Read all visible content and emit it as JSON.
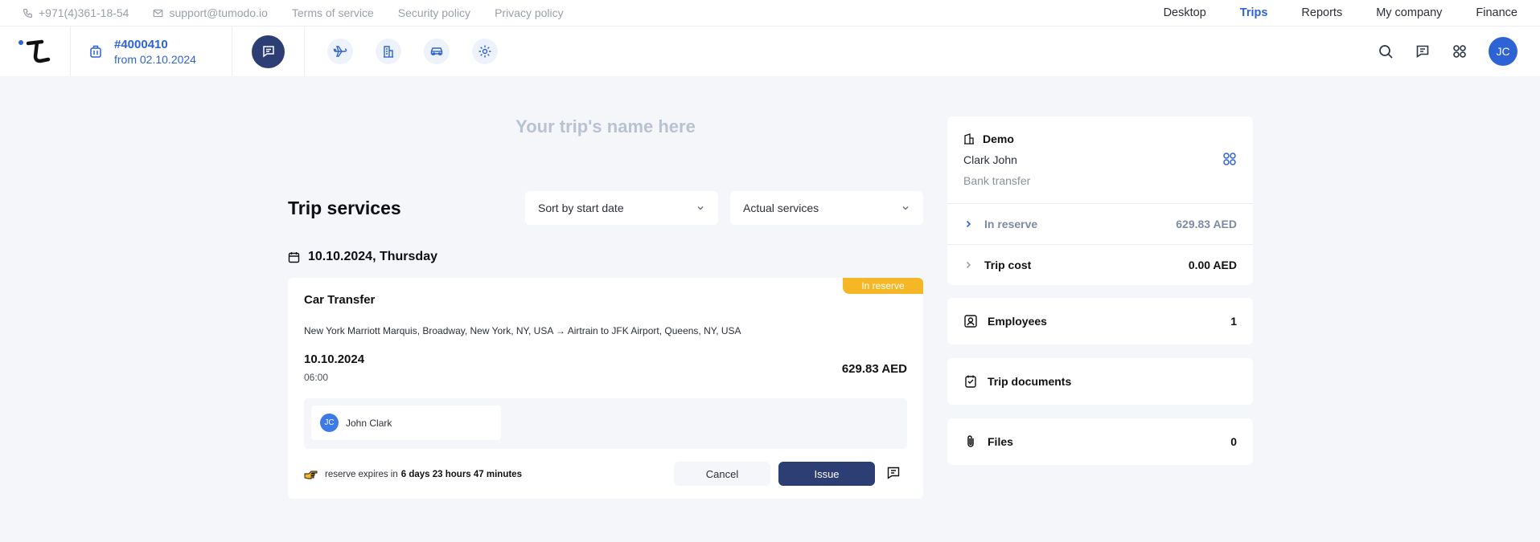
{
  "topbar": {
    "phone": "+971(4)361-18-54",
    "email": "support@tumodo.io",
    "links": [
      "Terms of service",
      "Security policy",
      "Privacy policy"
    ],
    "nav": [
      {
        "label": "Desktop",
        "active": false
      },
      {
        "label": "Trips",
        "active": true
      },
      {
        "label": "Reports",
        "active": false
      },
      {
        "label": "My company",
        "active": false
      },
      {
        "label": "Finance",
        "active": false
      }
    ]
  },
  "header": {
    "trip_number": "#4000410",
    "trip_from": "from 02.10.2024",
    "avatar_initials": "JC",
    "service_icons": [
      "airplane-icon",
      "hotel-icon",
      "car-icon",
      "settings-gear-icon"
    ],
    "right_icons": [
      "search-icon",
      "chat-icon",
      "apps-grid-icon"
    ]
  },
  "main": {
    "trip_name_placeholder": "Your trip's name here",
    "section_title": "Trip services",
    "sort_select": "Sort by start date",
    "filter_select": "Actual services",
    "date_heading": "10.10.2024, Thursday",
    "service": {
      "badge": "In reserve",
      "title": "Car Transfer",
      "route": "New York Marriott Marquis, Broadway, New York, NY, USA → Airtrain to JFK Airport, Queens, NY, USA",
      "date": "10.10.2024",
      "time": "06:00",
      "price": "629.83 AED",
      "traveller_initials": "JC",
      "traveller_name": "John Clark",
      "expire_prefix": "reserve expires in",
      "expire_value": "6 days 23 hours 47 minutes",
      "cancel_label": "Cancel",
      "issue_label": "Issue"
    }
  },
  "sidebar": {
    "org": "Demo",
    "person": "Clark John",
    "payment": "Bank transfer",
    "in_reserve_label": "In reserve",
    "in_reserve_amount": "629.83 AED",
    "trip_cost_label": "Trip cost",
    "trip_cost_amount": "0.00 AED",
    "employees_label": "Employees",
    "employees_count": "1",
    "documents_label": "Trip documents",
    "files_label": "Files",
    "files_count": "0"
  },
  "colors": {
    "accent": "#2d63d5",
    "dark_button": "#2d3e75",
    "badge": "#f5b726",
    "background": "#f4f6fa"
  }
}
